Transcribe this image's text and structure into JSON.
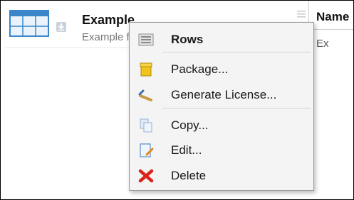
{
  "list": {
    "item": {
      "title": "Example",
      "subtitle": "Example f",
      "icon": "table-icon",
      "expand_icon": "download-arrow-icon",
      "menu_icon": "hamburger-icon"
    },
    "column": {
      "header": "Name",
      "cell": "Ex"
    }
  },
  "context_menu": {
    "items": [
      {
        "label": "Rows",
        "icon": "rows-list-icon",
        "header": true
      },
      {
        "label": "Package...",
        "icon": "package-box-icon"
      },
      {
        "label": "Generate License...",
        "icon": "license-key-icon"
      },
      {
        "label": "Copy...",
        "icon": "copy-icon"
      },
      {
        "label": "Edit...",
        "icon": "edit-document-icon"
      },
      {
        "label": "Delete",
        "icon": "delete-x-icon",
        "color": "#d9241b"
      }
    ]
  }
}
